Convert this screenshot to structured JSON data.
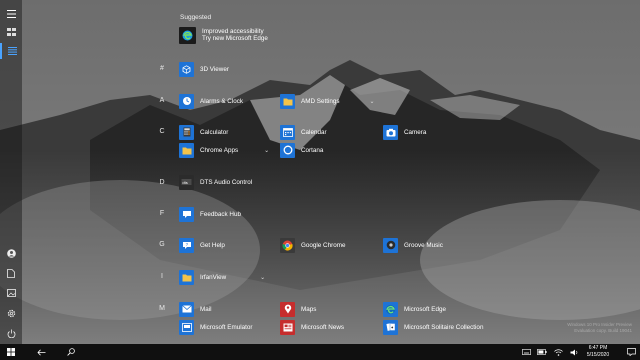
{
  "suggested": {
    "title": "Suggested",
    "line1": "Improved accessibility",
    "line2": "Try new Microsoft Edge"
  },
  "letters": [
    "#",
    "A",
    "C",
    "D",
    "F",
    "G",
    "I",
    "M"
  ],
  "apps": {
    "viewer3d": "3D Viewer",
    "alarms": "Alarms & Clock",
    "amd": "AMD Settings",
    "calculator": "Calculator",
    "calendar": "Calendar",
    "camera": "Camera",
    "chromeapps": "Chrome Apps",
    "cortana": "Cortana",
    "dts": "DTS Audio Control",
    "feedback": "Feedback Hub",
    "gethelp": "Get Help",
    "chrome": "Google Chrome",
    "groove": "Groove Music",
    "irfan": "IrfanView",
    "mail": "Mail",
    "maps": "Maps",
    "edge": "Microsoft Edge",
    "emulator": "Microsoft Emulator",
    "news": "Microsoft News",
    "solitaire": "Microsoft Solitaire Collection"
  },
  "clock": {
    "time": "6:47 PM",
    "date": "5/15/2020"
  },
  "watermark": {
    "line1": "Windows 10 Pro Insider Preview",
    "line2": "Evaluation copy. Build 19041"
  },
  "colors": {
    "tile_blue": "#1e73d6",
    "folder_yellow": "#f3c34a",
    "taskbar": "#101010",
    "accent": "#4aa3ff"
  }
}
